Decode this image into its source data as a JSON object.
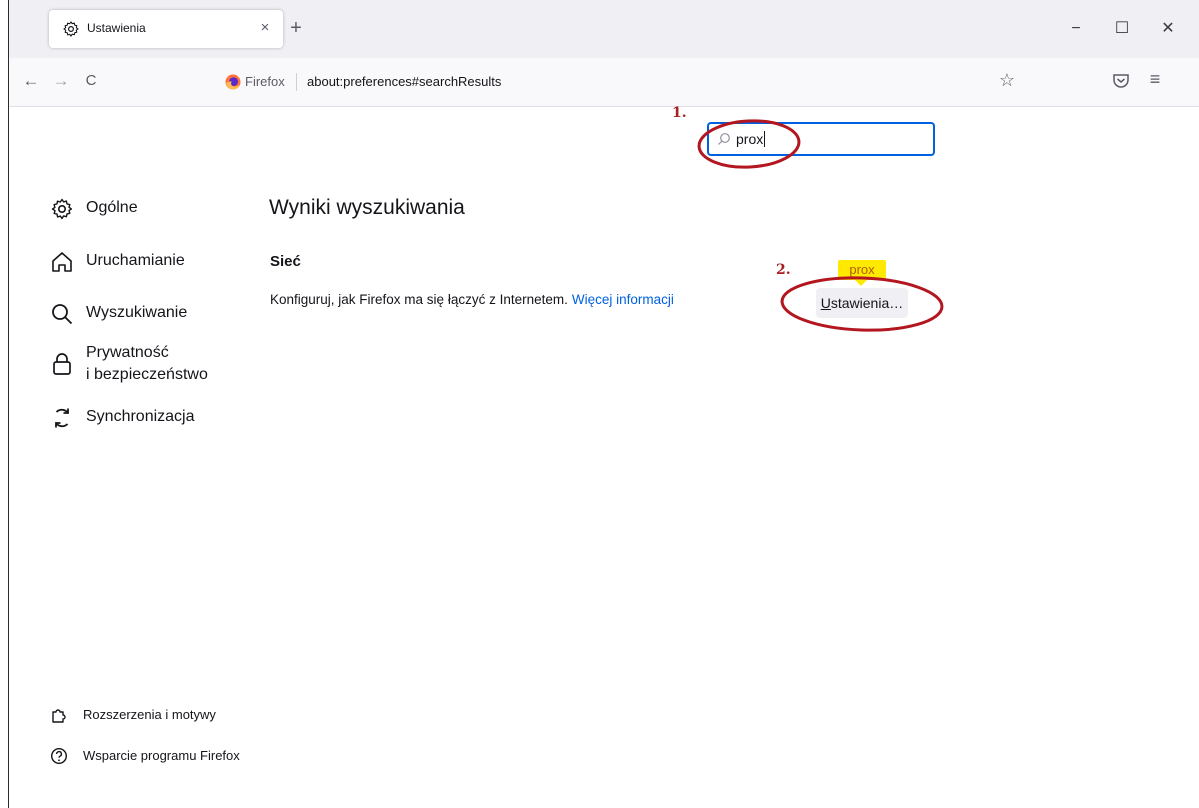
{
  "tab": {
    "title": "Ustawienia",
    "close_glyph": "×",
    "new_tab_glyph": "+"
  },
  "window": {
    "minimize_glyph": "−",
    "maximize_glyph": "☐",
    "close_glyph": "✕"
  },
  "nav": {
    "back_glyph": "←",
    "forward_glyph": "→",
    "reload_glyph": "C",
    "identity_label": "Firefox",
    "url": "about:preferences#searchResults",
    "bookmark_glyph": "☆",
    "menu_glyph": "≡"
  },
  "search": {
    "value": "prox"
  },
  "sidebar": {
    "items": [
      {
        "label": "Ogólne",
        "icon": "gear-icon"
      },
      {
        "label": "Uruchamianie",
        "icon": "home-icon"
      },
      {
        "label": "Wyszukiwanie",
        "icon": "search-icon"
      },
      {
        "label_line1": "Prywatność",
        "label_line2": "i bezpieczeństwo",
        "icon": "lock-icon"
      },
      {
        "label": "Synchronizacja",
        "icon": "sync-icon"
      }
    ],
    "footer": [
      {
        "label": "Rozszerzenia i motywy",
        "icon": "puzzle-icon"
      },
      {
        "label": "Wsparcie programu Firefox",
        "icon": "help-icon"
      }
    ]
  },
  "results": {
    "title": "Wyniki wyszukiwania",
    "section_title": "Sieć",
    "description": "Konfiguruj, jak Firefox ma się łączyć z Internetem.",
    "more_info": "Więcej informacji",
    "settings_button_first": "U",
    "settings_button_rest": "stawienia…",
    "tooltip": "prox"
  },
  "annotations": {
    "step1": "1.",
    "step2": "2.",
    "color": "#b3161e"
  },
  "colors": {
    "accent": "#0061e0",
    "tooltip_bg": "#ffe900"
  }
}
